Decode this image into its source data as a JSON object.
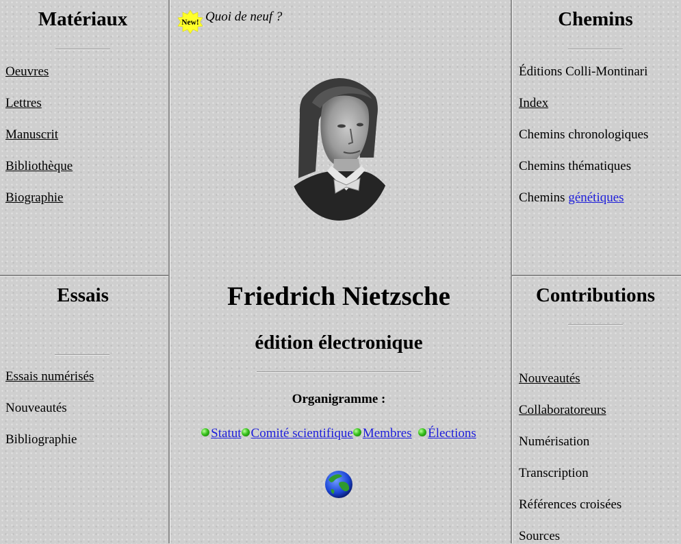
{
  "materiaux": {
    "title": "Matériaux",
    "links": [
      "Oeuvres",
      "Lettres",
      "Manuscrit",
      "Bibliothèque",
      "Biographie"
    ]
  },
  "essais": {
    "title": "Essais",
    "items": [
      {
        "label": "Essais numérisés",
        "link": true
      },
      {
        "label": "Nouveautés",
        "link": false
      },
      {
        "label": "Bibliographie",
        "link": false
      }
    ]
  },
  "header": {
    "new_badge": "New!",
    "whats_new": "Quoi de neuf ?"
  },
  "main": {
    "title": "Friedrich Nietzsche",
    "subtitle": "édition électronique",
    "organigramme_label": "Organigramme :",
    "org_links": [
      "Statut",
      "Comité scientifique",
      "Membres",
      "Élections"
    ]
  },
  "chemins": {
    "title": "Chemins",
    "item1": "Éditions Colli-Montinari",
    "item2_link": "Index",
    "item3": "Chemins chronologiques",
    "item4": "Chemins thématiques",
    "item5_prefix": "Chemins",
    "item5_link": "génétiques"
  },
  "contributions": {
    "title": "Contributions",
    "items": [
      {
        "label": "Nouveautés",
        "link": true
      },
      {
        "label": "Collaboratoreurs",
        "link": true
      },
      {
        "label": "Numérisation",
        "link": false
      },
      {
        "label": "Transcription",
        "link": false
      },
      {
        "label": "Références croisées",
        "link": false
      },
      {
        "label": "Sources",
        "link": false
      }
    ]
  },
  "colors": {
    "link": "#1d1ddb",
    "background": "#cfcfcf",
    "new_badge": "#ffff2a"
  }
}
